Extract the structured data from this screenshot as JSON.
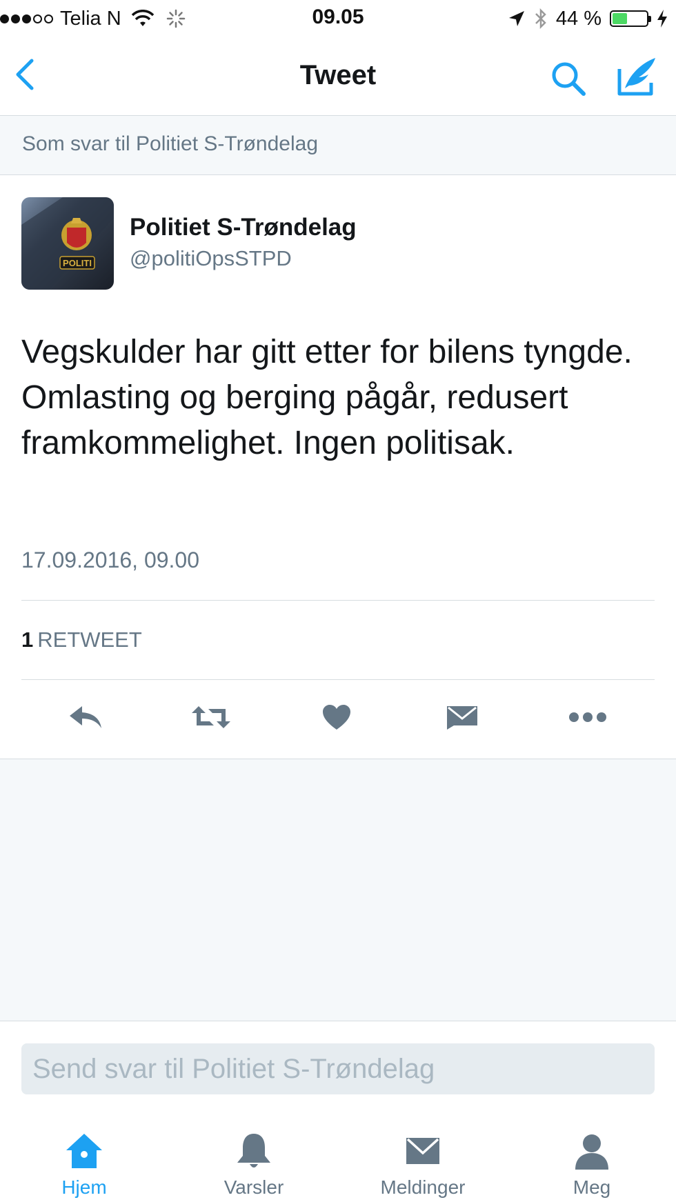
{
  "status_bar": {
    "carrier": "Telia N",
    "time": "09.05",
    "battery_text": "44 %",
    "battery_level": 0.44,
    "signal_bars_filled": 3,
    "signal_bars_total": 5
  },
  "nav": {
    "title": "Tweet",
    "back_icon": "chevron-left-icon",
    "search_icon": "search-icon",
    "compose_icon": "compose-icon"
  },
  "reply_context": "Som svar til Politiet S-Trøndelag",
  "tweet": {
    "author_name": "Politiet S-Trøndelag",
    "author_handle": "@politiOpsSTPD",
    "avatar_badge_text": "POLITI",
    "text": "Vegskulder har gitt etter for bilens tyngde. Omlasting og berging pågår, redusert framkommelighet. Ingen politisak.",
    "date": "17.09.2016, 09.00",
    "retweet_count": "1",
    "retweet_label": "RETWEET"
  },
  "actions": [
    {
      "name": "reply-icon"
    },
    {
      "name": "retweet-icon"
    },
    {
      "name": "like-icon"
    },
    {
      "name": "direct-message-icon"
    },
    {
      "name": "more-icon"
    }
  ],
  "composer": {
    "placeholder": "Send svar til Politiet S-Trøndelag"
  },
  "tabs": [
    {
      "label": "Hjem",
      "icon": "home-icon",
      "active": true
    },
    {
      "label": "Varsler",
      "icon": "bell-icon",
      "active": false
    },
    {
      "label": "Meldinger",
      "icon": "envelope-icon",
      "active": false
    },
    {
      "label": "Meg",
      "icon": "person-icon",
      "active": false
    }
  ],
  "colors": {
    "accent": "#1da1f2",
    "icon_gray": "#657786",
    "background_gray": "#f5f8fa"
  }
}
